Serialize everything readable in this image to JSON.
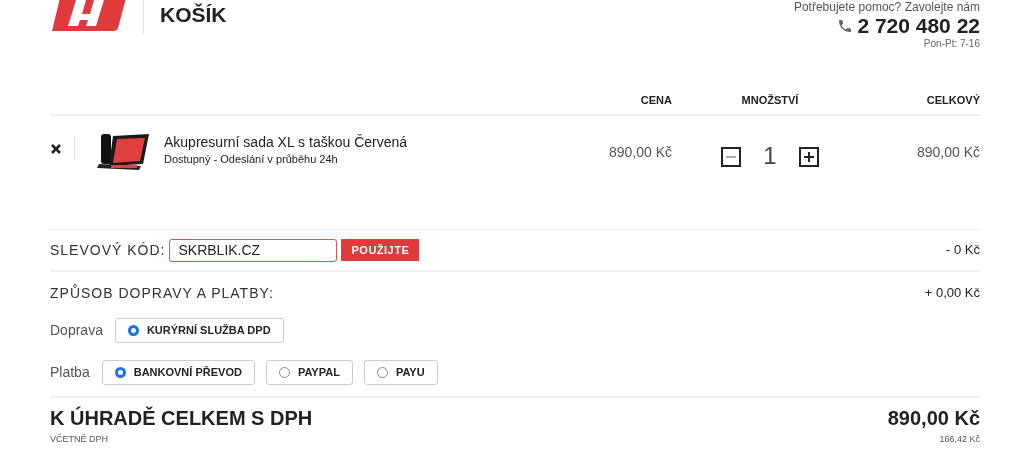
{
  "header": {
    "title": "KOŠÍK",
    "help_text": "Potřebujete pomoc? Zavolejte nám",
    "phone": "2 720 480 22",
    "hours": "Pon-Pt: 7-16"
  },
  "table": {
    "columns": [
      "CENA",
      "MNOŽSTVÍ",
      "CELKOVÝ"
    ],
    "rows": [
      {
        "name": "Akupresurní sada XL s taškou Červená",
        "availability": "Dostupný - Odeslání v průběhu 24h",
        "price": "890,00 Kč",
        "quantity": "1",
        "total": "890,00 Kč"
      }
    ]
  },
  "discount": {
    "label": "SLEVOVÝ KÓD:",
    "value": "SKRBLIK.CZ",
    "button": "POUŽIJTE",
    "amount": "- 0 Kč"
  },
  "shipping": {
    "label": "ZPŮSOB DOPRAVY A PLATBY:",
    "amount": "+ 0,00 Kč",
    "groups": [
      {
        "label": "Doprava",
        "options": [
          {
            "label": "KURÝRNÍ SLUŽBA DPD",
            "selected": true
          }
        ]
      },
      {
        "label": "Platba",
        "options": [
          {
            "label": "BANKOVNÍ PŘEVOD",
            "selected": true
          },
          {
            "label": "PAYPAL",
            "selected": false
          },
          {
            "label": "PAYU",
            "selected": false
          }
        ]
      }
    ]
  },
  "total": {
    "label": "K ÚHRADĚ CELKEM S DPH",
    "sublabel": "VČETNĚ DPH",
    "amount": "890,00 Kč",
    "vat": "166,42 Kč"
  }
}
